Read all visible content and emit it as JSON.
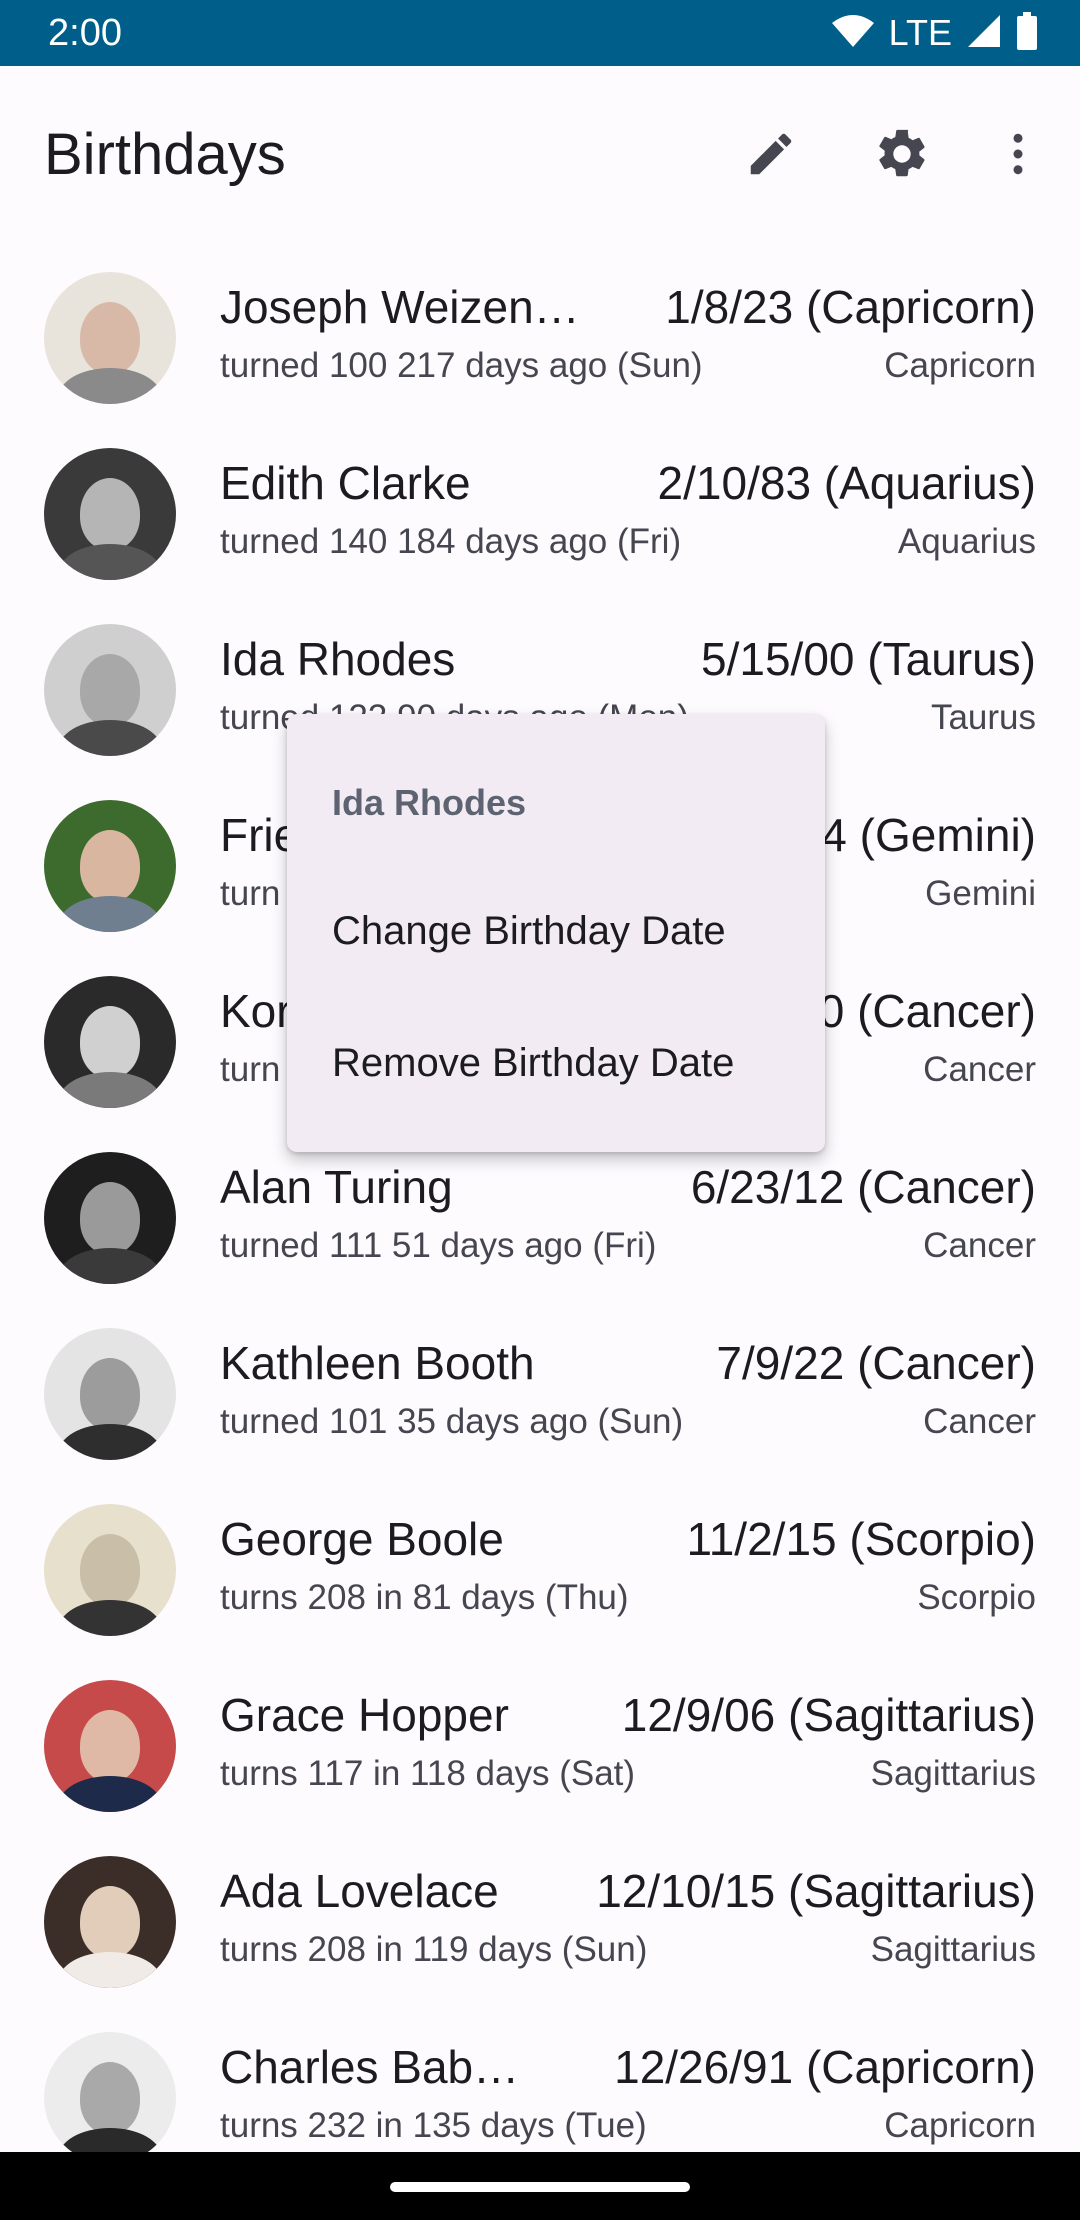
{
  "status_bar": {
    "time": "2:00",
    "network": "LTE",
    "icons": [
      "wifi-icon",
      "signal-icon",
      "battery-icon"
    ]
  },
  "app_bar": {
    "title": "Birthdays",
    "actions": [
      "edit-icon",
      "settings-icon",
      "more-vert-icon"
    ]
  },
  "birthdays": [
    {
      "name": "Joseph Weizen…",
      "date": "1/8/23 (Capricorn)",
      "subtitle": "turned 100 217 days ago (Sun)",
      "sign": "Capricorn"
    },
    {
      "name": "Edith Clarke",
      "date": "2/10/83 (Aquarius)",
      "subtitle": "turned 140 184 days ago (Fri)",
      "sign": "Aquarius"
    },
    {
      "name": "Ida Rhodes",
      "date": "5/15/00 (Taurus)",
      "subtitle": "turned 123 90 days ago (Mon)",
      "sign": "Taurus"
    },
    {
      "name": "Frie",
      "date": "4 (Gemini)",
      "subtitle": "turn",
      "sign": "Gemini"
    },
    {
      "name": "Kor",
      "date": "0 (Cancer)",
      "subtitle": "turn",
      "sign": "Cancer"
    },
    {
      "name": "Alan Turing",
      "date": "6/23/12 (Cancer)",
      "subtitle": "turned 111 51 days ago (Fri)",
      "sign": "Cancer"
    },
    {
      "name": "Kathleen Booth",
      "date": "7/9/22 (Cancer)",
      "subtitle": "turned 101 35 days ago (Sun)",
      "sign": "Cancer"
    },
    {
      "name": "George Boole",
      "date": "11/2/15 (Scorpio)",
      "subtitle": "turns 208 in 81 days (Thu)",
      "sign": "Scorpio"
    },
    {
      "name": "Grace Hopper",
      "date": "12/9/06 (Sagittarius)",
      "subtitle": "turns 117 in 118 days (Sat)",
      "sign": "Sagittarius"
    },
    {
      "name": "Ada Lovelace",
      "date": "12/10/15 (Sagittarius)",
      "subtitle": "turns 208 in 119 days (Sun)",
      "sign": "Sagittarius"
    },
    {
      "name": "Charles Bab…",
      "date": "12/26/91 (Capricorn)",
      "subtitle": "turns 232 in 135 days (Tue)",
      "sign": "Capricorn"
    }
  ],
  "context_menu": {
    "title": "Ida Rhodes",
    "items": [
      "Change Birthday Date",
      "Remove Birthday Date"
    ]
  },
  "colors": {
    "status_bar": "#005f8a",
    "background": "#fdfbfe",
    "menu_background": "#f2ebf4",
    "menu_header": "#5d6370"
  }
}
